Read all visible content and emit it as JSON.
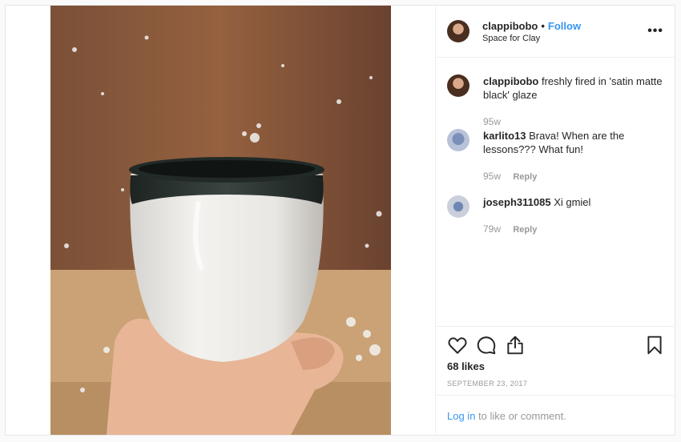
{
  "post": {
    "author": "clappibobo",
    "follow_label": "Follow",
    "dot": "•",
    "location": "Space for Clay",
    "more_label": "•••"
  },
  "comments": [
    {
      "user": "clappibobo",
      "text": "freshly fired in 'satin matte black' glaze",
      "time": "95w",
      "reply": ""
    },
    {
      "user": "karlito13",
      "text": "Brava! When are the lessons??? What fun!",
      "time": "95w",
      "reply": "Reply"
    },
    {
      "user": "joseph311085",
      "text": "Xi gmiel",
      "time": "79w",
      "reply": "Reply"
    }
  ],
  "stats": {
    "likes": "68 likes",
    "date": "SEPTEMBER 23, 2017"
  },
  "footer": {
    "login_label": "Log in",
    "rest": " to like or comment."
  },
  "colors": {
    "accent": "#3897f0",
    "muted": "#999999",
    "text": "#262626"
  }
}
